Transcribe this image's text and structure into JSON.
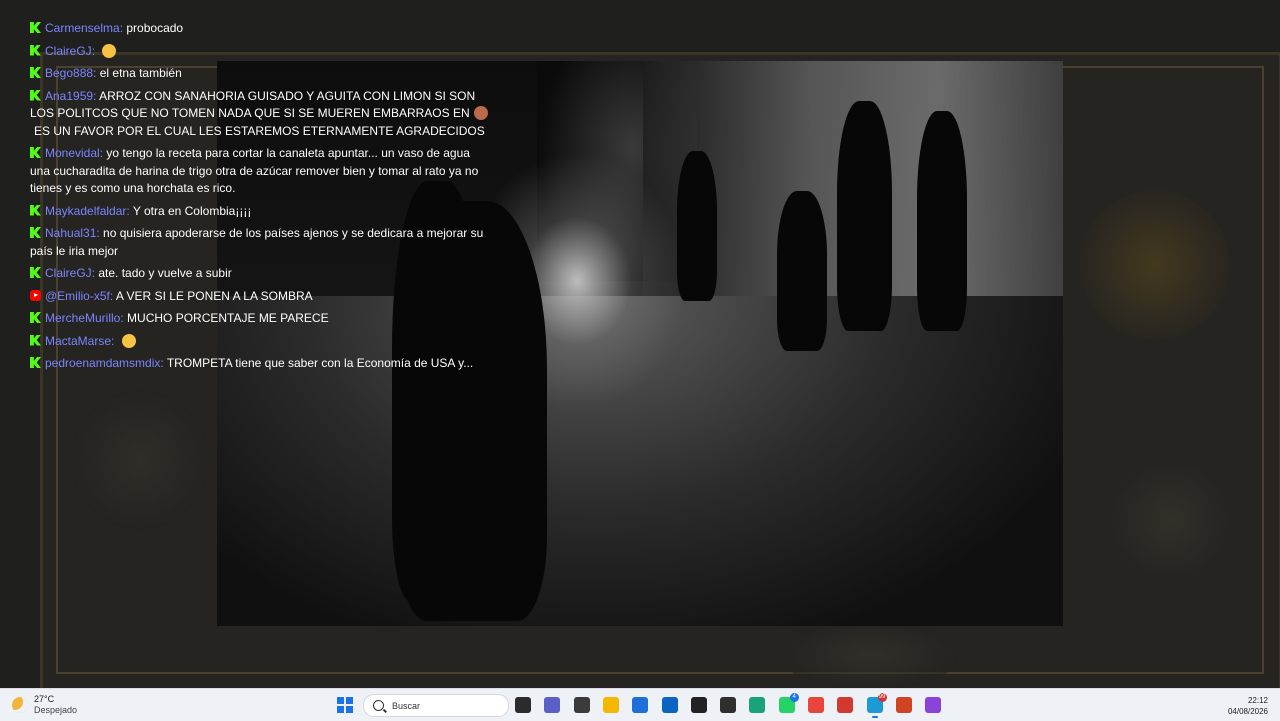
{
  "chat": {
    "messages": [
      {
        "platform": "kick",
        "user": "Carmenselma",
        "text": "probocado"
      },
      {
        "platform": "kick",
        "user": "ClaireGJ",
        "text": "",
        "emoji": "thinking-emoji"
      },
      {
        "platform": "kick",
        "user": "Bego888",
        "text": "el etna también"
      },
      {
        "platform": "kick",
        "user": "Ana1959",
        "text": "ARROZ CON SANAHORIA GUISADO Y AGUITA CON LIMON SI SON LOS POLITCOS QUE NO TOMEN NADA QUE SI SE MUEREN EMBARRAOS EN",
        "emoji": "poop-emoji",
        "text_after": "ES UN FAVOR POR EL CUAL LES ESTAREMOS ETERNAMENTE AGRADECIDOS"
      },
      {
        "platform": "kick",
        "user": "Monevidal",
        "text": "yo tengo la receta para cortar la canaleta apuntar... un vaso de agua una cucharadita de harina de trigo otra de azúcar remover bien y tomar al rato ya no tienes y es como una horchata es rico."
      },
      {
        "platform": "kick",
        "user": "Maykadelfaldar",
        "text": "Y otra en Colombia¡¡¡¡"
      },
      {
        "platform": "kick",
        "user": "Nahual31",
        "text": "no quisiera apoderarse de los países ajenos y se dedicara a mejorar su país le iria mejor"
      },
      {
        "platform": "kick",
        "user": "ClaireGJ",
        "text": "ate. tado y vuelve a subir"
      },
      {
        "platform": "youtube",
        "user": "@Emilio-x5f",
        "text": "A VER SI LE PONEN A LA SOMBRA"
      },
      {
        "platform": "kick",
        "user": "MercheMurillo",
        "text": "MUCHO PORCENTAJE ME PARECE"
      },
      {
        "platform": "kick",
        "user": "MactaMarse",
        "text": "",
        "emoji": "hugging-emoji"
      },
      {
        "platform": "kick",
        "user": "pedroenamdamsmdix",
        "text": "TROMPETA tiene que saber con la Economía de USA y..."
      }
    ]
  },
  "taskbar": {
    "weather_temp": "27°C",
    "weather_desc": "Despejado",
    "search_placeholder": "Buscar",
    "time": "22:12",
    "date": "04/08/2026",
    "icons": [
      {
        "name": "task-view-icon",
        "color": "#2b2b2b"
      },
      {
        "name": "teams-icon",
        "color": "#5b5fc7"
      },
      {
        "name": "snipping-tool-icon",
        "color": "#3b3b3b"
      },
      {
        "name": "file-explorer-icon",
        "color": "#f5b800"
      },
      {
        "name": "microsoft-store-icon",
        "color": "#1e6fd9"
      },
      {
        "name": "outlook-icon",
        "color": "#0a64c2"
      },
      {
        "name": "obs-icon",
        "color": "#222222"
      },
      {
        "name": "app-cube-icon",
        "color": "#2f2f2f"
      },
      {
        "name": "edge-icon",
        "color": "#18a37a"
      },
      {
        "name": "whatsapp-icon",
        "color": "#25d366",
        "badge": "4"
      },
      {
        "name": "chrome-icon",
        "color": "#e8453c"
      },
      {
        "name": "chrome-profile-icon",
        "color": "#d33a2f"
      },
      {
        "name": "app-active-icon",
        "color": "#1b9ad6",
        "badge": "99"
      },
      {
        "name": "powerpoint-icon",
        "color": "#d04423"
      },
      {
        "name": "circle-app-icon",
        "color": "#8a43d8"
      }
    ]
  }
}
